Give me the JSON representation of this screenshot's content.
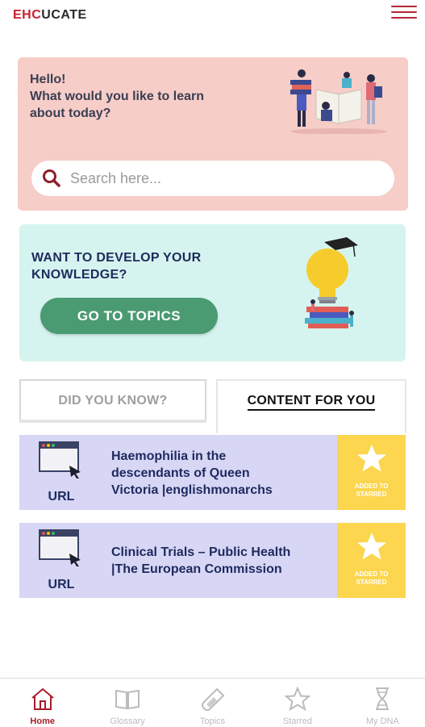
{
  "header": {
    "logo_part1": "EHC",
    "logo_part2": "UCATE",
    "menu_icon": "hamburger-icon"
  },
  "hello_card": {
    "greeting": "Hello!",
    "prompt_line1": "What would you like to learn",
    "prompt_line2": "about today?",
    "illustration": "students-reading-illustration"
  },
  "search": {
    "placeholder": "Search here...",
    "value": "",
    "icon": "search-icon"
  },
  "develop_card": {
    "line1": "WANT TO DEVELOP YOUR",
    "line2": "KNOWLEDGE?",
    "button_label": "GO TO TOPICS",
    "illustration": "lightbulb-graduation-illustration"
  },
  "tabs": [
    {
      "label": "DID YOU KNOW?",
      "active": false
    },
    {
      "label": "CONTENT FOR YOU",
      "active": true
    }
  ],
  "content_items": [
    {
      "type_label": "URL",
      "title_lines": [
        "Haemophilia in the",
        "descendants of Queen",
        "Victoria |englishmonarchs"
      ],
      "star_line1": "ADDED TO",
      "star_line2": "STARRED"
    },
    {
      "type_label": "URL",
      "title_lines": [
        "Clinical Trials – Public Health",
        "|The European Commission"
      ],
      "star_line1": "ADDED TO",
      "star_line2": "STARRED"
    }
  ],
  "bottom_nav": [
    {
      "label": "Home",
      "icon": "home-icon",
      "active": true
    },
    {
      "label": "Glossary",
      "icon": "book-icon",
      "active": false
    },
    {
      "label": "Topics",
      "icon": "test-tube-icon",
      "active": false
    },
    {
      "label": "Starred",
      "icon": "star-icon",
      "active": false
    },
    {
      "label": "My DNA",
      "icon": "dna-hourglass-icon",
      "active": false
    }
  ],
  "colors": {
    "brand_red": "#c8202f",
    "hello_bg": "#f7cdc8",
    "develop_bg": "#d6f4ef",
    "button_green": "#4a9a72",
    "card_bg": "#d8d6f5",
    "star_yellow": "#fbd64e"
  }
}
